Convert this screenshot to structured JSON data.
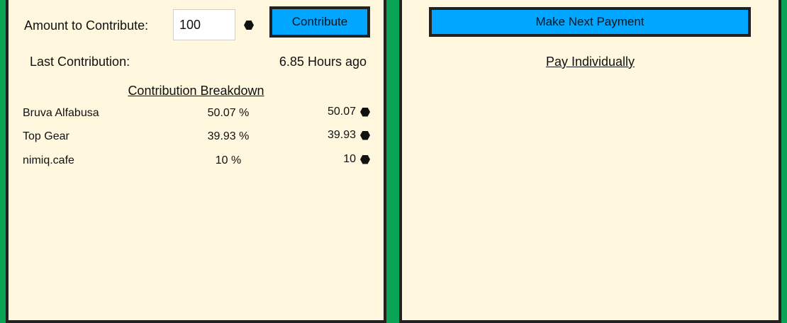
{
  "contribute_panel": {
    "amount_label": "Amount to Contribute:",
    "amount_value": "100",
    "contribute_button": "Contribute",
    "last_contribution_label": "Last Contribution:",
    "last_contribution_value": "6.85 Hours ago",
    "breakdown_title": "Contribution Breakdown",
    "breakdown": [
      {
        "name": "Bruva Alfabusa",
        "percent": "50.07 %",
        "amount": "50.07"
      },
      {
        "name": "Top Gear",
        "percent": "39.93 %",
        "amount": "39.93"
      },
      {
        "name": "nimiq.cafe",
        "percent": "10 %",
        "amount": "10"
      }
    ],
    "currency_icon": "nimiq-hexagon-icon"
  },
  "payment_panel": {
    "next_payment_button": "Make Next Payment",
    "pay_individually_link": "Pay Individually"
  },
  "colors": {
    "background": "#0aa456",
    "panel": "#fff7de",
    "button": "#00a6ff",
    "border": "#222222"
  }
}
